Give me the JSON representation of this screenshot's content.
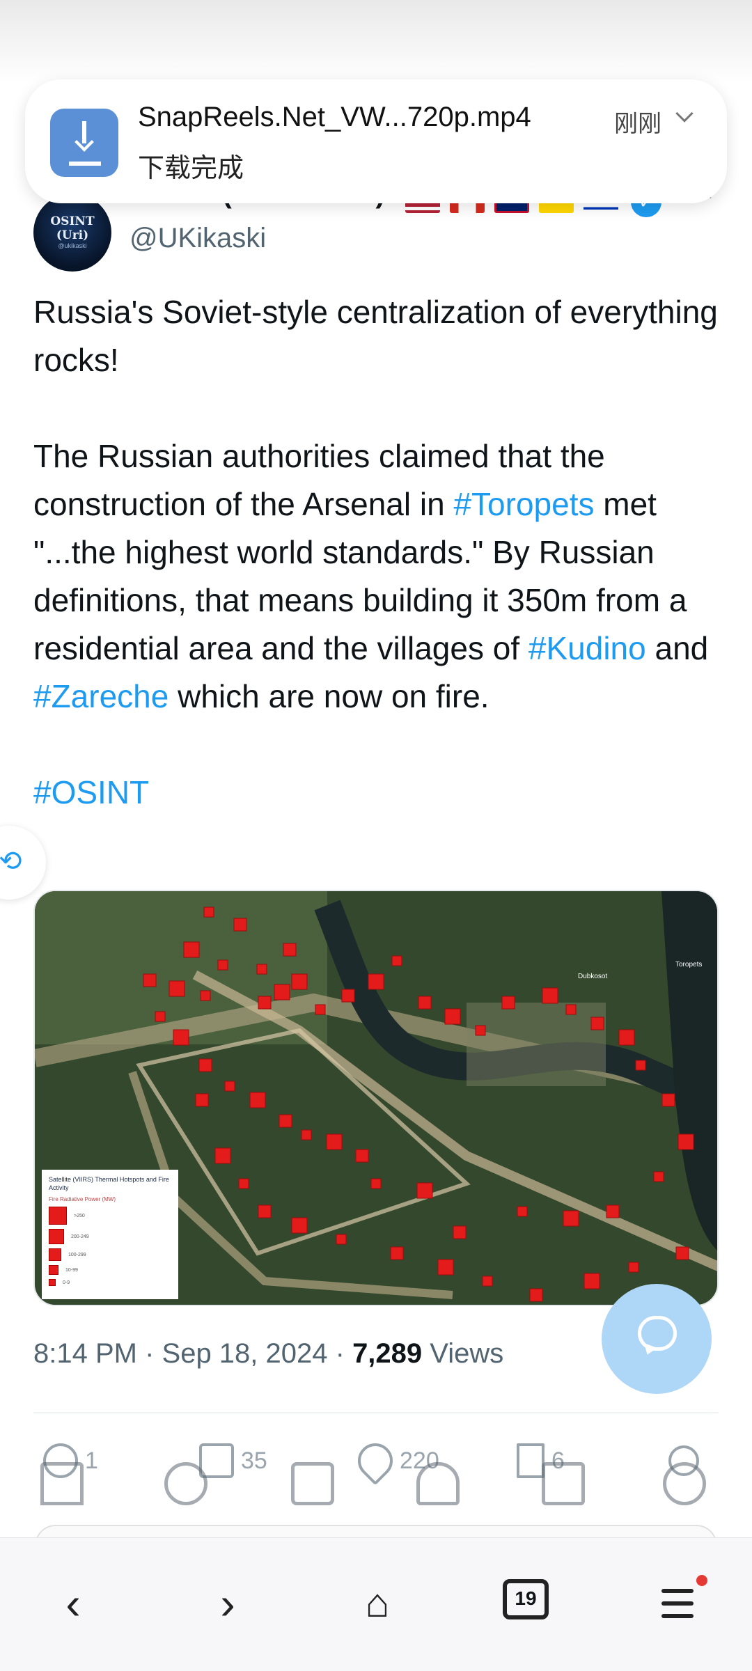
{
  "download_toast": {
    "filename": "SnapReels.Net_VW...720p.mp4",
    "status": "下载完成",
    "time": "刚刚",
    "icon": "download-icon"
  },
  "author": {
    "display_name": "OSINT (Uri Kikaski)",
    "handle": "@UKikaski",
    "avatar_text": "OSINT (Uri)",
    "avatar_subtext": "@ukikaski",
    "verified": true,
    "badge_color": "#1d9bf0"
  },
  "tweet": {
    "para1": "Russia's Soviet-style centralization of everything rocks!",
    "para2_parts": [
      "The Russian authorities claimed that the construction of the Arsenal in ",
      "#Toropets",
      " met \"...the highest world standards.\" By Russian definitions, that means building it 350m from a residential area and the villages of ",
      "#Kudino",
      " and ",
      "#Zareche",
      " which are now on fire."
    ],
    "hashtag": "#OSINT",
    "link_color": "#1d9bf0"
  },
  "media": {
    "legend_title": "Satellite (VIIRS) Thermal Hotspots and Fire Activity",
    "legend_subtitle": "Fire Radiative Power (MW)",
    "legend_items": [
      ">250",
      "200-249",
      "100-299",
      "10-99",
      "0-9"
    ],
    "place_labels": [
      "Dubkosot",
      "Toropets"
    ],
    "marker_color": "#e31b1b"
  },
  "meta": {
    "time": "8:14 PM",
    "date": "Sep 18, 2024",
    "views_count": "7,289",
    "views_label": "Views"
  },
  "engagement": {
    "replies": "1",
    "reposts": "35",
    "likes": "220",
    "bookmarks": "6"
  },
  "browser": {
    "tab_count": "19"
  }
}
